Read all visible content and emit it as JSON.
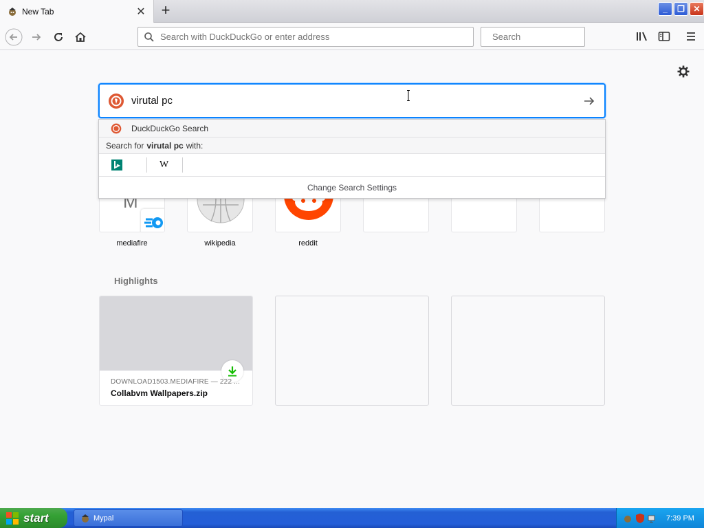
{
  "tab": {
    "title": "New Tab",
    "close": "✕",
    "new": "+"
  },
  "window": {
    "minimize": "_",
    "restore": "❐",
    "close": "✕"
  },
  "nav": {
    "url_placeholder": "Search with DuckDuckGo or enter address",
    "search_placeholder": "Search"
  },
  "search": {
    "query": "virutal pc",
    "suggestion": "DuckDuckGo Search",
    "search_for_prefix": "Search for",
    "search_for_term": "virutal pc",
    "search_for_suffix": "with:",
    "engines": [
      "bing-icon",
      "wikipedia-icon"
    ],
    "wikipedia_glyph": "W",
    "settings": "Change Search Settings"
  },
  "topsites": [
    {
      "label": "mediafire",
      "letter": "M"
    },
    {
      "label": "wikipedia"
    },
    {
      "label": "reddit"
    },
    {
      "label": ""
    },
    {
      "label": ""
    },
    {
      "label": ""
    }
  ],
  "highlights": {
    "title": "Highlights",
    "card": {
      "source": "DOWNLOAD1503.MEDIAFIRE — 222 ...",
      "title": "Collabvm Wallpapers.zip"
    }
  },
  "taskbar": {
    "start": "start",
    "item": "Mypal",
    "time": "7:39 PM"
  },
  "colors": {
    "focus": "#0a84ff",
    "reddit": "#ff4500",
    "download": "#12bc00"
  }
}
